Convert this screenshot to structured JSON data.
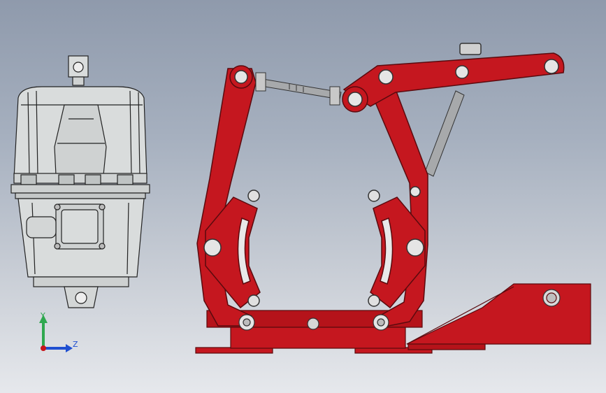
{
  "triad": {
    "y_label": "Y",
    "z_label": "Z"
  },
  "colors": {
    "brake_red": "#c5171f",
    "brake_red_dark": "#8c0e14",
    "thruster_gray": "#d9dcdc",
    "rod_gray": "#a7a9ab",
    "axis_y": "#2fa84f",
    "axis_z": "#1f4fd1",
    "origin": "#c8141a"
  },
  "parts": {
    "thruster": "electro-hydraulic-thruster-icon",
    "brake_arm_left": "brake-arm-left-icon",
    "brake_arm_right": "brake-arm-right-icon",
    "brake_shoe_left": "brake-shoe-left-icon",
    "brake_shoe_right": "brake-shoe-right-icon",
    "top_lever": "top-lever-icon",
    "pull_rod": "pull-rod-icon",
    "spring_rod": "spring-rod-icon",
    "base_plate": "base-plate-icon",
    "thruster_bracket": "thruster-bracket-icon"
  }
}
